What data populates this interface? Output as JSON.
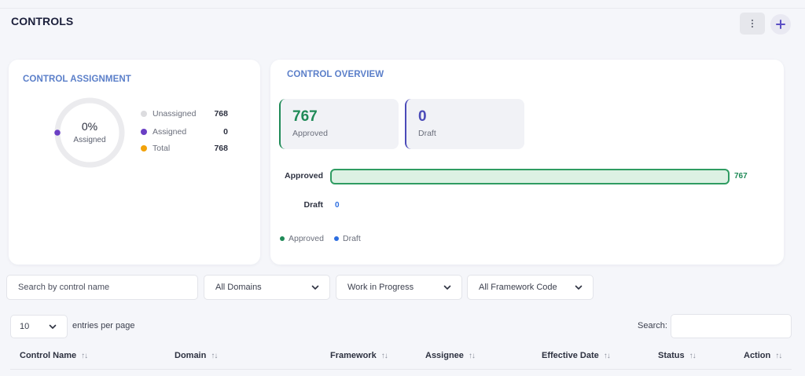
{
  "header": {
    "title": "CONTROLS",
    "more_icon": "vertical-dots-icon",
    "add_icon": "plus-icon",
    "accent": "#5b4fc4"
  },
  "assignment": {
    "title": "CONTROL ASSIGNMENT",
    "percent": "0%",
    "percent_value": 0,
    "percent_label": "Assigned",
    "legend": [
      {
        "label": "Unassigned",
        "value": "768",
        "color": "#dcdcdf"
      },
      {
        "label": "Assigned",
        "value": "0",
        "color": "#6a3fc4"
      },
      {
        "label": "Total",
        "value": "768",
        "color": "#f2a20a"
      }
    ]
  },
  "overview": {
    "title": "CONTROL OVERVIEW",
    "stats": [
      {
        "value": "767",
        "label": "Approved",
        "color": "#1f8a57"
      },
      {
        "value": "0",
        "label": "Draft",
        "color": "#4b4bb8"
      }
    ],
    "bars": [
      {
        "label": "Approved",
        "value": "767",
        "color": "#1f8a57"
      },
      {
        "label": "Draft",
        "value": "0",
        "color": "#2d6ee0"
      }
    ],
    "legend": [
      {
        "label": "Approved",
        "color": "#1f8a57"
      },
      {
        "label": "Draft",
        "color": "#2d6ee0"
      }
    ]
  },
  "filters": {
    "search_placeholder": "Search by control name",
    "domain": "All Domains",
    "status": "Work in Progress",
    "framework": "All Framework Code"
  },
  "table": {
    "entries_value": "10",
    "entries_label": "entries per page",
    "search_label": "Search:",
    "columns": [
      "Control Name",
      "Domain",
      "Framework",
      "Assignee",
      "Effective Date",
      "Status",
      "Action"
    ],
    "sort_icon": "sort-arrows-icon"
  }
}
